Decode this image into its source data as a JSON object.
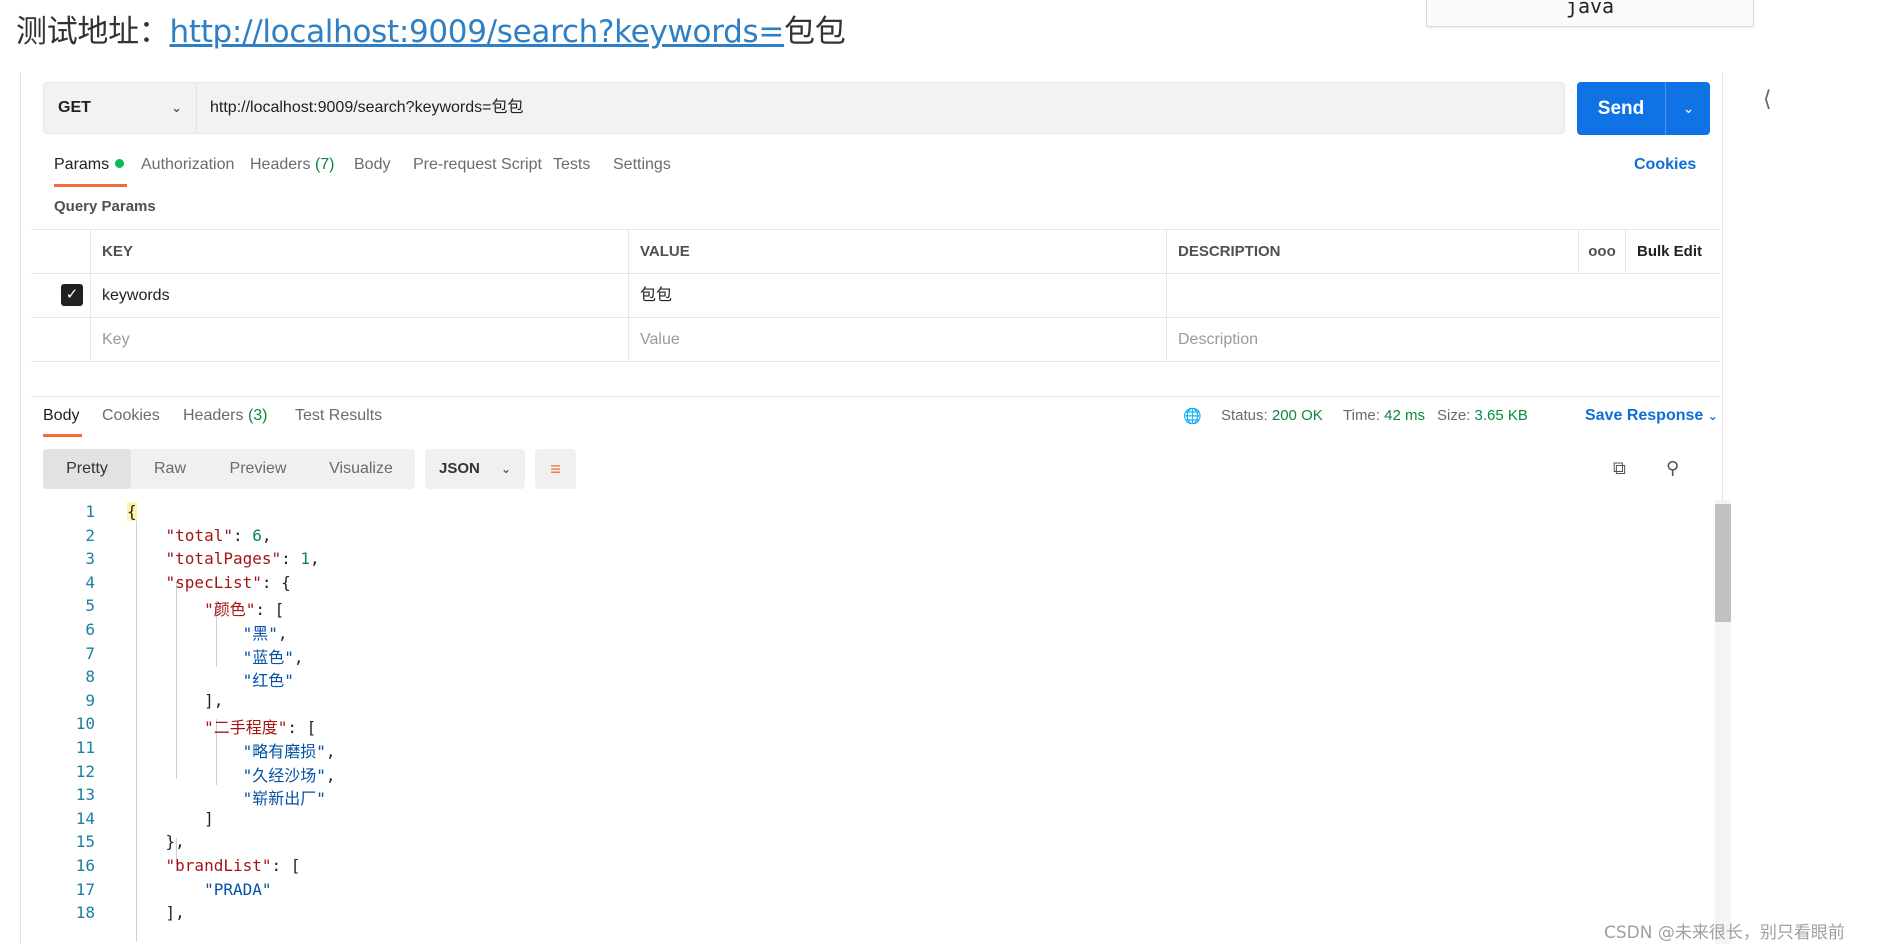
{
  "doc": {
    "label": "测试地址：",
    "url": "http://localhost:9009/search?keywords=",
    "suffix": "包包",
    "code_tab": "java"
  },
  "request": {
    "method": "GET",
    "url": "http://localhost:9009/search?keywords=包包",
    "send_label": "Send"
  },
  "tabs": {
    "params": "Params",
    "authorization": "Authorization",
    "headers": "Headers",
    "headers_count": "(7)",
    "body": "Body",
    "prerequest": "Pre-request Script",
    "tests": "Tests",
    "settings": "Settings",
    "cookies": "Cookies"
  },
  "query_params": {
    "title": "Query Params",
    "headers": {
      "key": "KEY",
      "value": "VALUE",
      "description": "DESCRIPTION",
      "more": "ooo",
      "bulk_edit": "Bulk Edit"
    },
    "rows": [
      {
        "key": "keywords",
        "value": "包包",
        "description": ""
      }
    ],
    "placeholders": {
      "key": "Key",
      "value": "Value",
      "description": "Description"
    }
  },
  "response": {
    "tabs": {
      "body": "Body",
      "cookies": "Cookies",
      "headers": "Headers",
      "headers_count": "(3)",
      "test_results": "Test Results"
    },
    "status_label": "Status:",
    "status_value": "200 OK",
    "time_label": "Time:",
    "time_value": "42 ms",
    "size_label": "Size:",
    "size_value": "3.65 KB",
    "save_response": "Save Response",
    "views": [
      "Pretty",
      "Raw",
      "Preview",
      "Visualize"
    ],
    "format": "JSON"
  },
  "code_lines": [
    {
      "n": "1",
      "html": "<span style=\"background:#fff3b0\">{</span>"
    },
    {
      "n": "2",
      "html": "    <span class=\"k\">\"total\"</span>: <span class=\"n\">6</span>,"
    },
    {
      "n": "3",
      "html": "    <span class=\"k\">\"totalPages\"</span>: <span class=\"n\">1</span>,"
    },
    {
      "n": "4",
      "html": "    <span class=\"k\">\"specList\"</span>: {"
    },
    {
      "n": "5",
      "html": "        <span class=\"k\">\"颜色\"</span>: ["
    },
    {
      "n": "6",
      "html": "            <span class=\"s\">\"黑\"</span>,"
    },
    {
      "n": "7",
      "html": "            <span class=\"s\">\"蓝色\"</span>,"
    },
    {
      "n": "8",
      "html": "            <span class=\"s\">\"红色\"</span>"
    },
    {
      "n": "9",
      "html": "        ],"
    },
    {
      "n": "10",
      "html": "        <span class=\"k\">\"二手程度\"</span>: ["
    },
    {
      "n": "11",
      "html": "            <span class=\"s\">\"略有磨损\"</span>,"
    },
    {
      "n": "12",
      "html": "            <span class=\"s\">\"久经沙场\"</span>,"
    },
    {
      "n": "13",
      "html": "            <span class=\"s\">\"崭新出厂\"</span>"
    },
    {
      "n": "14",
      "html": "        ]"
    },
    {
      "n": "15",
      "html": "    },"
    },
    {
      "n": "16",
      "html": "    <span class=\"k\">\"brandList\"</span>: ["
    },
    {
      "n": "17",
      "html": "        <span class=\"s\">\"PRADA\"</span>"
    },
    {
      "n": "18",
      "html": "    ],"
    }
  ],
  "watermark": "CSDN @未来很长，别只看眼前"
}
